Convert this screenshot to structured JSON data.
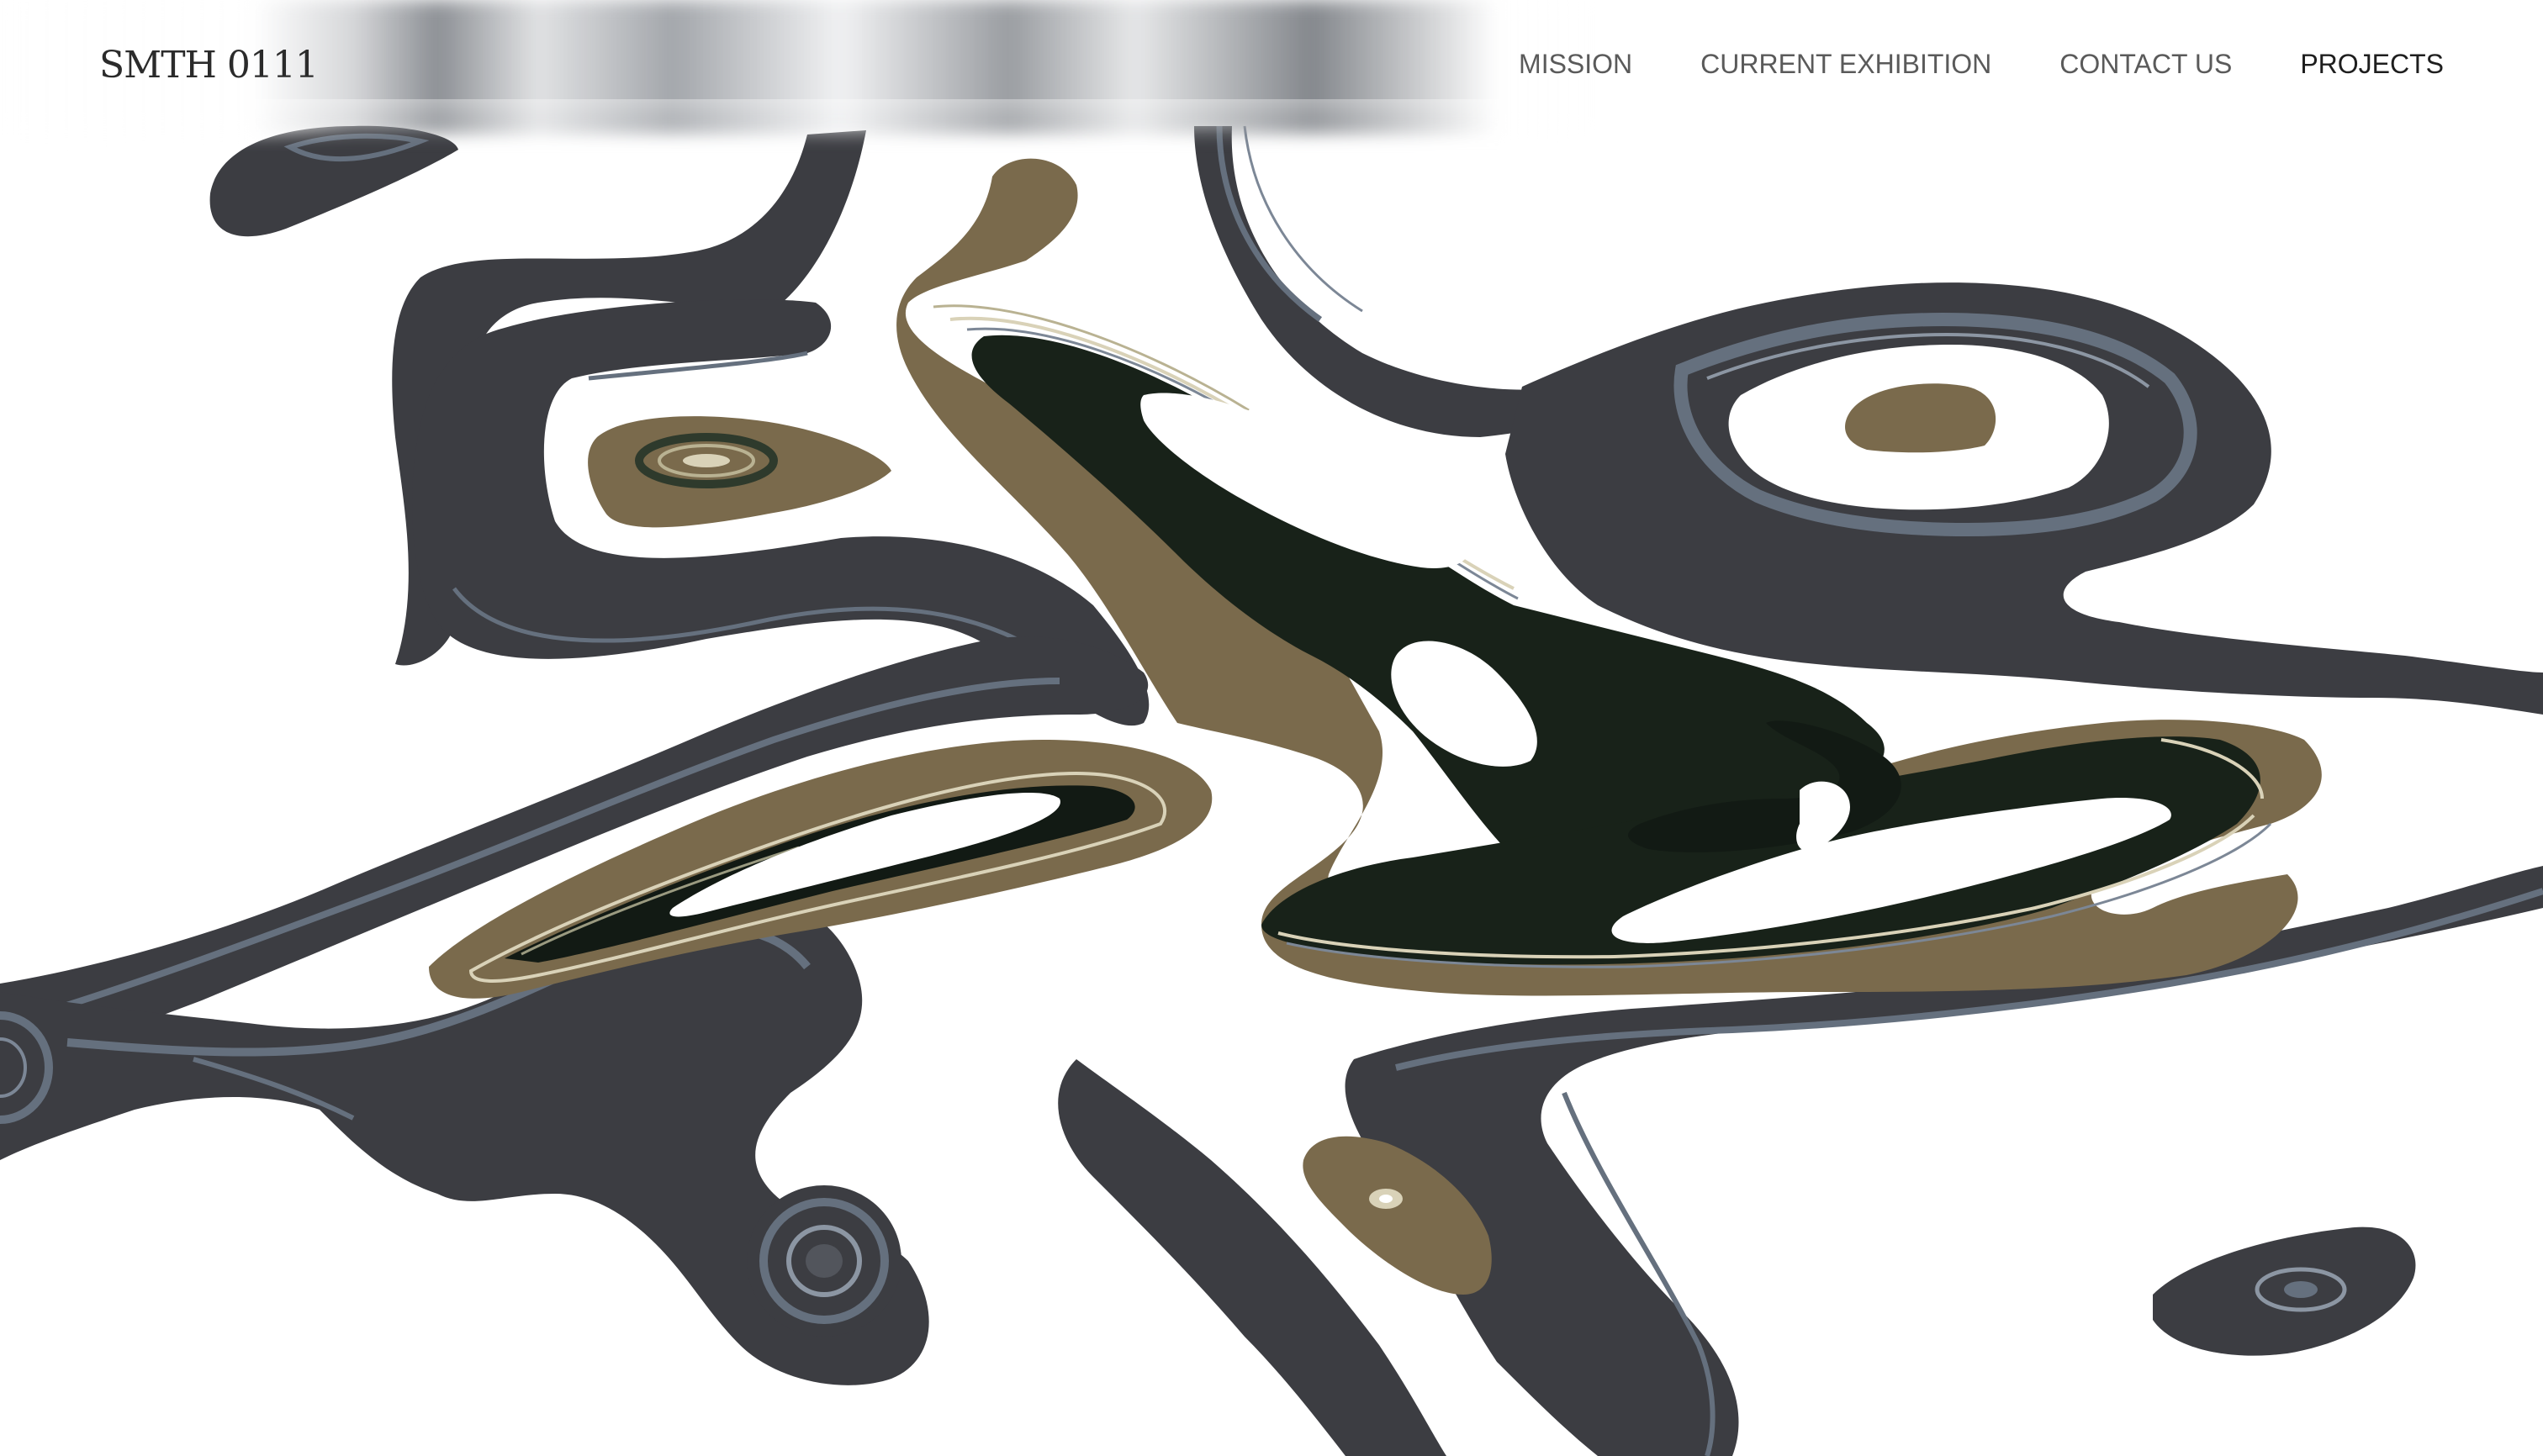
{
  "brand": {
    "logo_text": "SMTH 0111"
  },
  "nav": {
    "items": [
      {
        "label": "MISSION",
        "active": false
      },
      {
        "label": "CURRENT EXHIBITION",
        "active": false
      },
      {
        "label": "CONTACT US",
        "active": false
      },
      {
        "label": "PROJECTS",
        "active": true
      }
    ]
  },
  "colors": {
    "background": "#ffffff",
    "slate": "#3c3d42",
    "steel_blue": "#65707e",
    "olive": "#7a6a4c",
    "deep_green": "#162018",
    "cream": "#d9d2b8",
    "text": "#2b2b2b",
    "nav_text": "#5a5a5a"
  }
}
